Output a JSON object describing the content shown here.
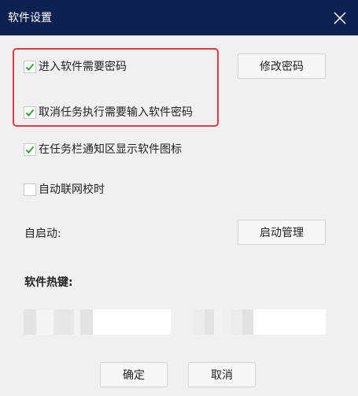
{
  "window": {
    "title": "软件设置"
  },
  "options": [
    {
      "label": "进入软件需要密码",
      "checked": true
    },
    {
      "label": "取消任务执行需要输入软件密码",
      "checked": true
    },
    {
      "label": "在任务栏通知区显示软件图标",
      "checked": true
    },
    {
      "label": "自动联网校时",
      "checked": false
    }
  ],
  "buttons": {
    "change_password": "修改密码",
    "startup_manage": "启动管理",
    "ok": "确定",
    "cancel": "取消"
  },
  "startup": {
    "label": "自启动:"
  },
  "hotkey": {
    "label": "软件热键:",
    "value_1": "",
    "value_2": ""
  },
  "colors": {
    "titlebar": "#0e2252",
    "highlight_border": "#e2383d",
    "check_mark": "#36a336",
    "dialog_background": "#f0f0f0"
  },
  "icons": {
    "close": "close-icon",
    "check": "check-icon"
  }
}
